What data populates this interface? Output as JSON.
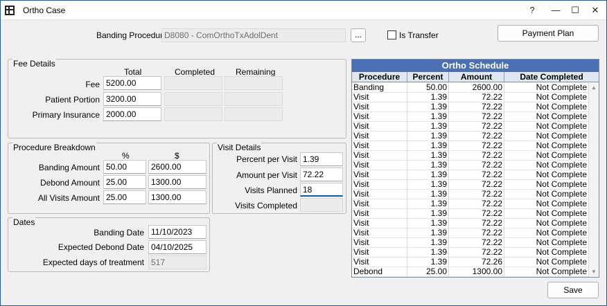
{
  "window": {
    "title": "Ortho Case",
    "help": "?",
    "minimize": "—",
    "maximize": "☐",
    "close": "✕"
  },
  "banding": {
    "label": "Banding Procedure",
    "value": "D8080 - ComOrthoTxAdolDent",
    "browse_label": "...",
    "transfer_label": "Is Transfer",
    "payment_plan_label": "Payment Plan"
  },
  "fee_details": {
    "title": "Fee Details",
    "col_total": "Total",
    "col_completed": "Completed",
    "col_remaining": "Remaining",
    "rows": [
      {
        "label": "Fee",
        "total": "5200.00"
      },
      {
        "label": "Patient Portion",
        "total": "3200.00"
      },
      {
        "label": "Primary Insurance",
        "total": "2000.00"
      }
    ]
  },
  "procedure_breakdown": {
    "title": "Procedure Breakdown",
    "col_percent": "%",
    "col_amount": "$",
    "rows": [
      {
        "label": "Banding Amount",
        "percent": "50.00",
        "amount": "2600.00"
      },
      {
        "label": "Debond Amount",
        "percent": "25.00",
        "amount": "1300.00"
      },
      {
        "label": "All Visits Amount",
        "percent": "25.00",
        "amount": "1300.00"
      }
    ]
  },
  "visit_details": {
    "title": "Visit Details",
    "percent_label": "Percent per Visit",
    "percent_value": "1.39",
    "amount_label": "Amount per Visit",
    "amount_value": "72.22",
    "planned_label": "Visits Planned",
    "planned_value": "18",
    "completed_label": "Visits Completed"
  },
  "dates": {
    "title": "Dates",
    "banding_label": "Banding Date",
    "banding_value": "11/10/2023",
    "debond_label": "Expected Debond Date",
    "debond_value": "04/10/2025",
    "days_label": "Expected days of treatment",
    "days_value": "517"
  },
  "schedule": {
    "title": "Ortho Schedule",
    "headers": {
      "procedure": "Procedure",
      "percent": "Percent",
      "amount": "Amount",
      "date_completed": "Date Completed"
    },
    "rows": [
      {
        "procedure": "Banding",
        "percent": "50.00",
        "amount": "2600.00",
        "status": "Not Complete"
      },
      {
        "procedure": "Visit",
        "percent": "1.39",
        "amount": "72.22",
        "status": "Not Complete"
      },
      {
        "procedure": "Visit",
        "percent": "1.39",
        "amount": "72.22",
        "status": "Not Complete"
      },
      {
        "procedure": "Visit",
        "percent": "1.39",
        "amount": "72.22",
        "status": "Not Complete"
      },
      {
        "procedure": "Visit",
        "percent": "1.39",
        "amount": "72.22",
        "status": "Not Complete"
      },
      {
        "procedure": "Visit",
        "percent": "1.39",
        "amount": "72.22",
        "status": "Not Complete"
      },
      {
        "procedure": "Visit",
        "percent": "1.39",
        "amount": "72.22",
        "status": "Not Complete"
      },
      {
        "procedure": "Visit",
        "percent": "1.39",
        "amount": "72.22",
        "status": "Not Complete"
      },
      {
        "procedure": "Visit",
        "percent": "1.39",
        "amount": "72.22",
        "status": "Not Complete"
      },
      {
        "procedure": "Visit",
        "percent": "1.39",
        "amount": "72.22",
        "status": "Not Complete"
      },
      {
        "procedure": "Visit",
        "percent": "1.39",
        "amount": "72.22",
        "status": "Not Complete"
      },
      {
        "procedure": "Visit",
        "percent": "1.39",
        "amount": "72.22",
        "status": "Not Complete"
      },
      {
        "procedure": "Visit",
        "percent": "1.39",
        "amount": "72.22",
        "status": "Not Complete"
      },
      {
        "procedure": "Visit",
        "percent": "1.39",
        "amount": "72.22",
        "status": "Not Complete"
      },
      {
        "procedure": "Visit",
        "percent": "1.39",
        "amount": "72.22",
        "status": "Not Complete"
      },
      {
        "procedure": "Visit",
        "percent": "1.39",
        "amount": "72.22",
        "status": "Not Complete"
      },
      {
        "procedure": "Visit",
        "percent": "1.39",
        "amount": "72.22",
        "status": "Not Complete"
      },
      {
        "procedure": "Visit",
        "percent": "1.39",
        "amount": "72.22",
        "status": "Not Complete"
      },
      {
        "procedure": "Visit",
        "percent": "1.39",
        "amount": "72.26",
        "status": "Not Complete"
      },
      {
        "procedure": "Debond",
        "percent": "25.00",
        "amount": "1300.00",
        "status": "Not Complete"
      }
    ]
  },
  "save_label": "Save",
  "colors": {
    "schedule_title_bg": "#4a6fb4",
    "focus_accent": "#0b5fa8"
  }
}
